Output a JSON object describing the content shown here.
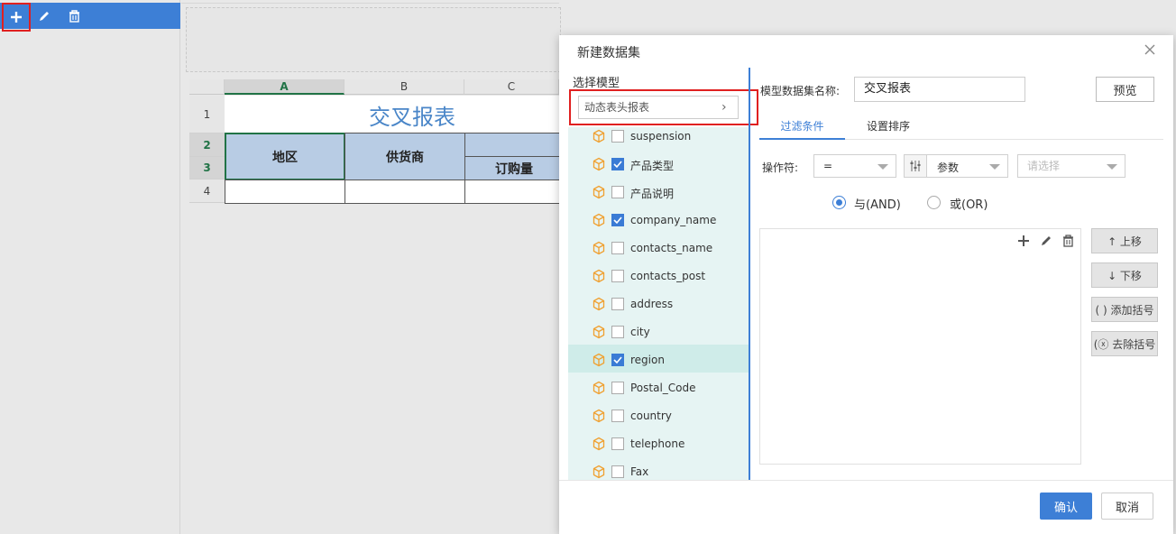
{
  "left_toolbar": {
    "icons": [
      "plus-icon",
      "pencil-icon",
      "trash-icon"
    ]
  },
  "sheet": {
    "columns": [
      "A",
      "B",
      "C"
    ],
    "rows": [
      "1",
      "2",
      "3",
      "4"
    ],
    "title": "交叉报表",
    "header_region": "地区",
    "header_supplier": "供货商",
    "header_order_qty": "订购量"
  },
  "dialog": {
    "title": "新建数据集",
    "model_label": "选择模型",
    "model_value": "动态表头报表",
    "name_label": "模型数据集名称:",
    "name_value": "交叉报表",
    "preview_label": "预览",
    "tabs": [
      {
        "label": "过滤条件",
        "active": true
      },
      {
        "label": "设置排序",
        "active": false
      }
    ],
    "operator_label": "操作符:",
    "operator_value": "=",
    "param_value": "参数",
    "select_placeholder": "请选择",
    "logic_and": "与(AND)",
    "logic_or": "或(OR)",
    "logic_selected": "AND",
    "move_up": "↑ 上移",
    "move_down": "↓ 下移",
    "add_bracket": "( ) 添加括号",
    "remove_bracket": "(ⓧ 去除括号",
    "ok_label": "确认",
    "cancel_label": "取消",
    "fields": [
      {
        "label": "suspension",
        "checked": false,
        "selected": false
      },
      {
        "label": "产品类型",
        "checked": true,
        "selected": false
      },
      {
        "label": "产品说明",
        "checked": false,
        "selected": false
      },
      {
        "label": "company_name",
        "checked": true,
        "selected": false
      },
      {
        "label": "contacts_name",
        "checked": false,
        "selected": false
      },
      {
        "label": "contacts_post",
        "checked": false,
        "selected": false
      },
      {
        "label": "address",
        "checked": false,
        "selected": false
      },
      {
        "label": "city",
        "checked": false,
        "selected": false
      },
      {
        "label": "region",
        "checked": true,
        "selected": true
      },
      {
        "label": "Postal_Code",
        "checked": false,
        "selected": false
      },
      {
        "label": "country",
        "checked": false,
        "selected": false
      },
      {
        "label": "telephone",
        "checked": false,
        "selected": false
      },
      {
        "label": "Fax",
        "checked": false,
        "selected": false
      }
    ],
    "colors": {
      "accent": "#3d7fd6",
      "highlight": "#e02020",
      "field_bg": "#e6f4f3",
      "header_cell": "#b8cce4",
      "title_text": "#4a86c8"
    }
  }
}
